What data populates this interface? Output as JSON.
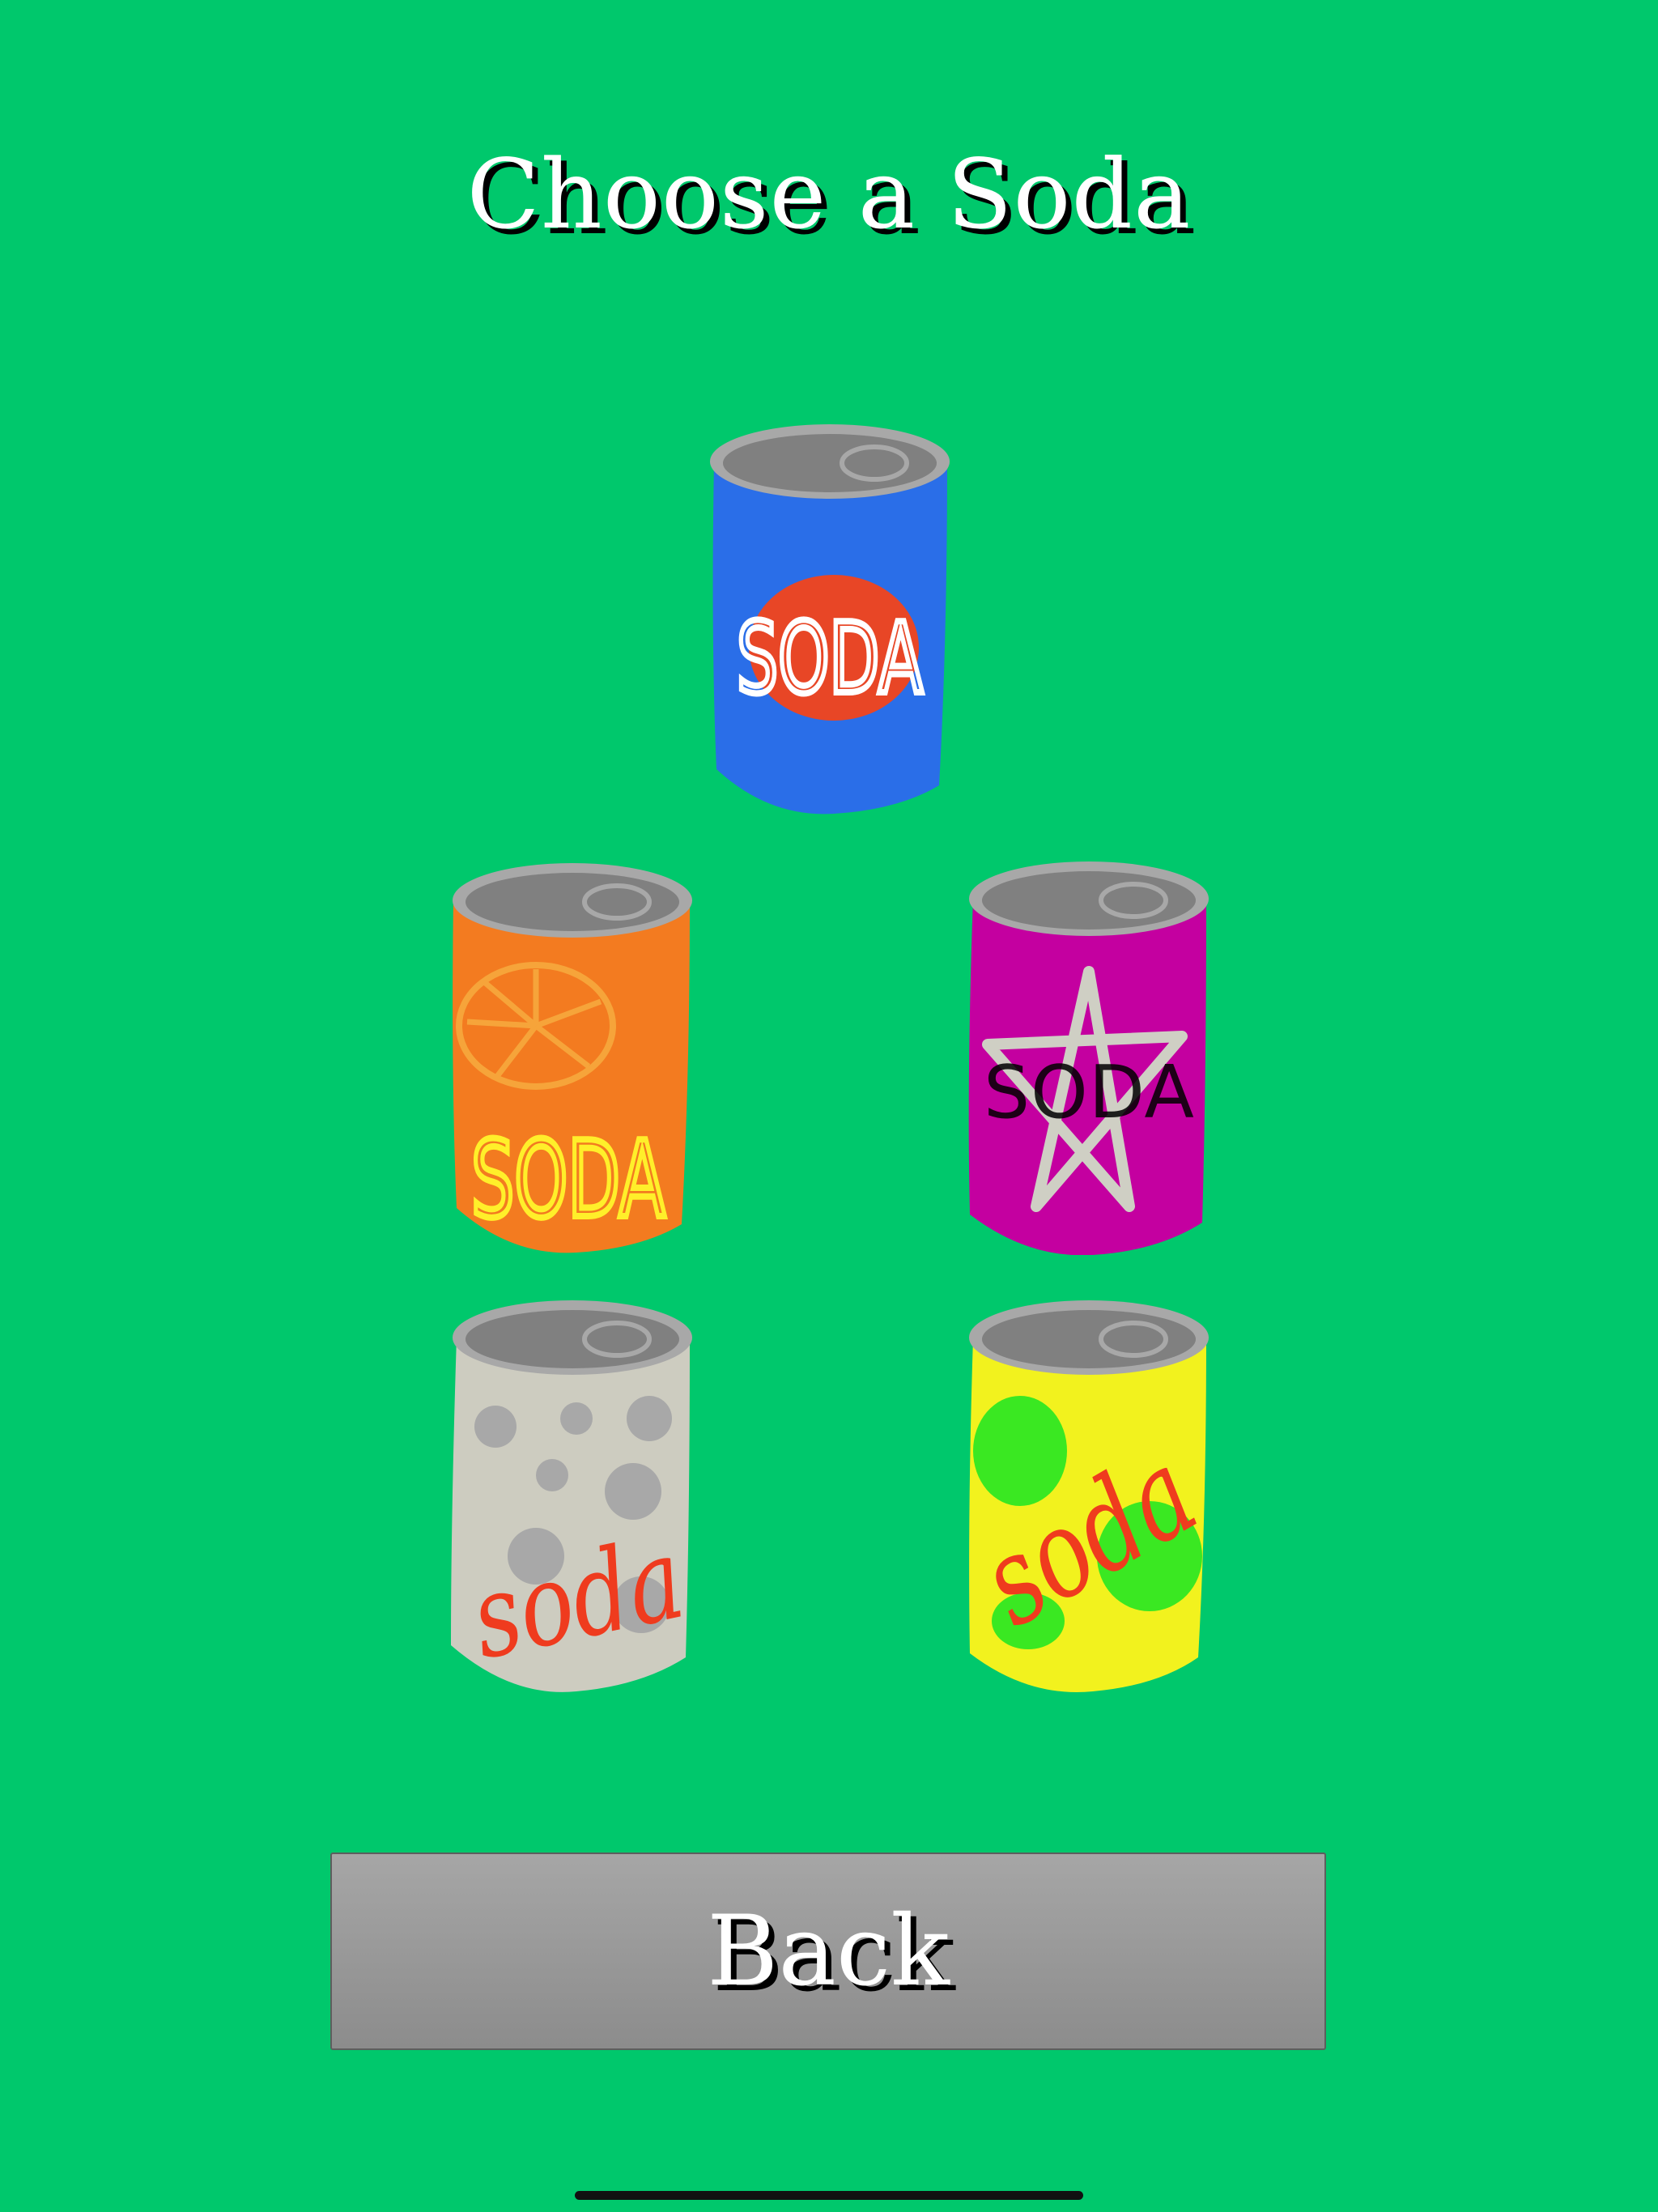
{
  "screen": {
    "title": "Choose a Soda",
    "background_color": "#00c86c"
  },
  "cans": [
    {
      "name": "blue-cola",
      "label": "SODA",
      "body_color": "#2a6ee8",
      "accent_color": "#e84626",
      "text_color": "#ffffff"
    },
    {
      "name": "orange-soda",
      "label": "SODA",
      "body_color": "#f37b20",
      "accent_color": "#f6a43a",
      "text_color": "#ffef2a"
    },
    {
      "name": "star-soda",
      "label": "SODA",
      "body_color": "#c400a0",
      "accent_color": "#cfcfc4",
      "text_color": "#000000"
    },
    {
      "name": "sparkling-soda",
      "label": "soda",
      "body_color": "#cdccc0",
      "accent_color": "#a8a8a8",
      "text_color": "#ef3b1e"
    },
    {
      "name": "lemon-lime-soda",
      "label": "soda",
      "body_color": "#f2f21e",
      "accent_color": "#3ae822",
      "text_color": "#ef3b1e"
    }
  ],
  "back_button": {
    "label": "Back"
  }
}
